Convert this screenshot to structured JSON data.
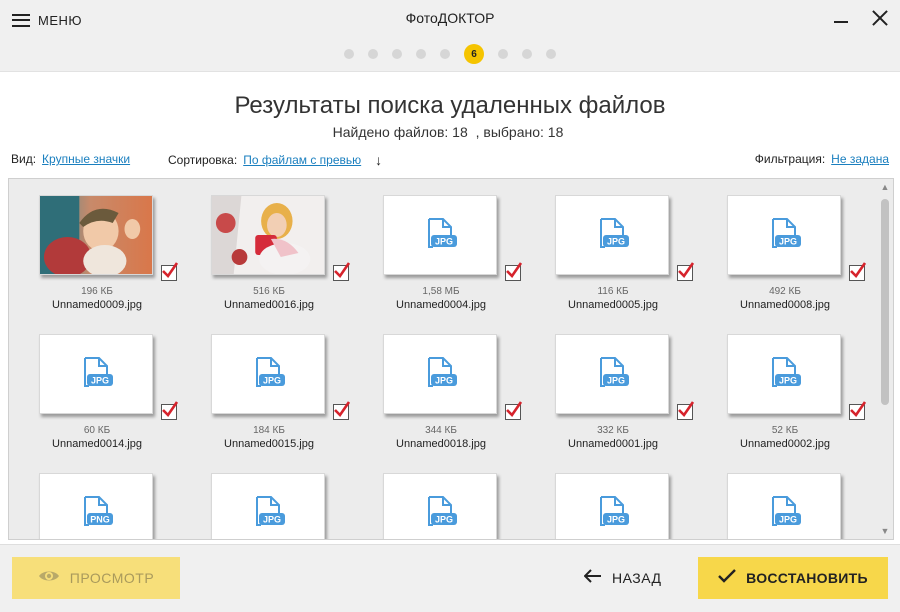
{
  "header": {
    "menu_label": "МЕНЮ",
    "app_title": "ФотоДОКТОР",
    "steps": {
      "total": 9,
      "active_label": "6"
    }
  },
  "title": {
    "heading": "Результаты поиска удаленных файлов",
    "found_text": "Найдено файлов: 18",
    "selected_text": ", выбрано: 18"
  },
  "options": {
    "view_label": "Вид:",
    "view_value": "Крупные значки",
    "sort_label": "Сортировка:",
    "sort_value": "По файлам с превью",
    "filter_label": "Фильтрация:",
    "filter_value": "Не задана"
  },
  "files": [
    {
      "name": "Unnamed0009.jpg",
      "size": "196 КБ",
      "type": "photo-baby",
      "checked": true
    },
    {
      "name": "Unnamed0016.jpg",
      "size": "516 КБ",
      "type": "photo-girl",
      "checked": true
    },
    {
      "name": "Unnamed0004.jpg",
      "size": "1,58 МБ",
      "type": "JPG",
      "checked": true
    },
    {
      "name": "Unnamed0005.jpg",
      "size": "116 КБ",
      "type": "JPG",
      "checked": true
    },
    {
      "name": "Unnamed0008.jpg",
      "size": "492 КБ",
      "type": "JPG",
      "checked": true
    },
    {
      "name": "Unnamed0014.jpg",
      "size": "60 КБ",
      "type": "JPG",
      "checked": true
    },
    {
      "name": "Unnamed0015.jpg",
      "size": "184 КБ",
      "type": "JPG",
      "checked": true
    },
    {
      "name": "Unnamed0018.jpg",
      "size": "344 КБ",
      "type": "JPG",
      "checked": true
    },
    {
      "name": "Unnamed0001.jpg",
      "size": "332 КБ",
      "type": "JPG",
      "checked": true
    },
    {
      "name": "Unnamed0002.jpg",
      "size": "52 КБ",
      "type": "JPG",
      "checked": true
    },
    {
      "name": "",
      "size": "",
      "type": "PNG",
      "checked": false
    },
    {
      "name": "",
      "size": "",
      "type": "JPG",
      "checked": false
    },
    {
      "name": "",
      "size": "",
      "type": "JPG",
      "checked": false
    },
    {
      "name": "",
      "size": "",
      "type": "JPG",
      "checked": false
    },
    {
      "name": "",
      "size": "",
      "type": "JPG",
      "checked": false
    }
  ],
  "footer": {
    "preview_label": "ПРОСМОТР",
    "back_label": "НАЗАД",
    "restore_label": "ВОССТАНОВИТЬ"
  },
  "colors": {
    "accent": "#f5c400",
    "link": "#1a7fbf",
    "file_icon": "#4a9bdc",
    "check": "#d6232c"
  }
}
